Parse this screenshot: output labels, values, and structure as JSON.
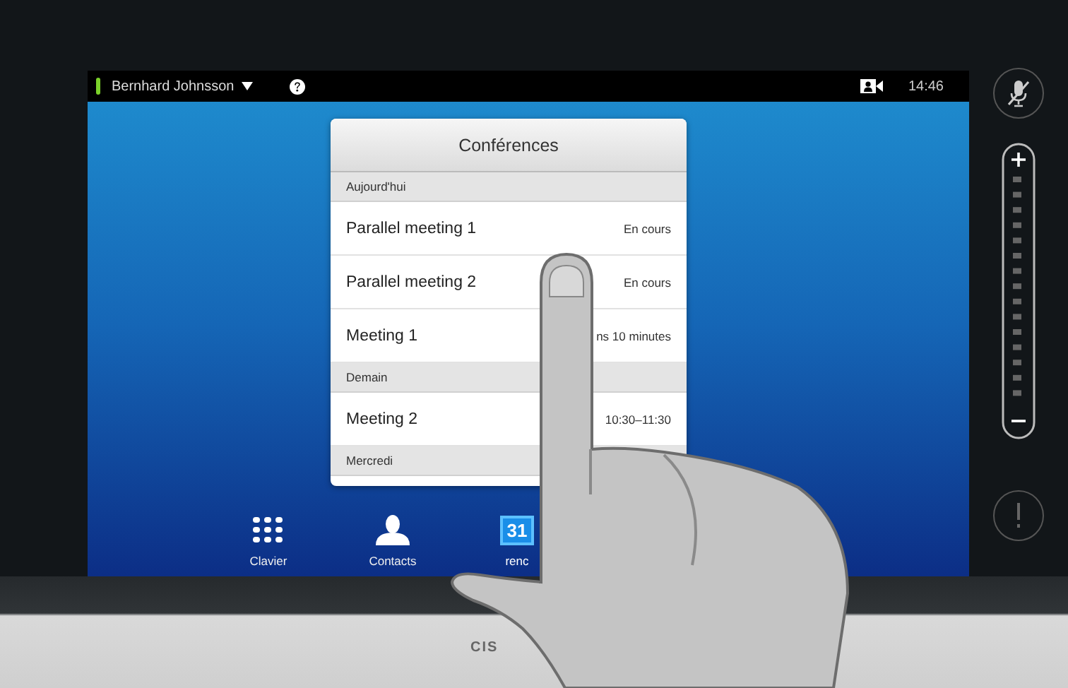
{
  "status_bar": {
    "user_name": "Bernhard Johnsson",
    "time": "14:46"
  },
  "dialog": {
    "title": "Conférences",
    "sections": [
      {
        "label": "Aujourd'hui",
        "rows": [
          {
            "name": "Parallel meeting 1",
            "status": "En cours"
          },
          {
            "name": "Parallel meeting 2",
            "status": "En cours"
          },
          {
            "name": "Meeting 1",
            "status": "ns 10 minutes"
          }
        ]
      },
      {
        "label": "Demain",
        "rows": [
          {
            "name": "Meeting 2",
            "status": "10:30–11:30"
          }
        ]
      },
      {
        "label": "Mercredi"
      }
    ]
  },
  "dock": [
    {
      "kind": "keypad",
      "label": "Clavier",
      "selected": false
    },
    {
      "kind": "contacts",
      "label": "Contacts",
      "selected": false
    },
    {
      "kind": "calendar",
      "icon_text": "31",
      "label": "renc",
      "selected": true
    }
  ],
  "side": {
    "mic_muted": true
  },
  "bezel": {
    "logo_text": "CIS"
  }
}
